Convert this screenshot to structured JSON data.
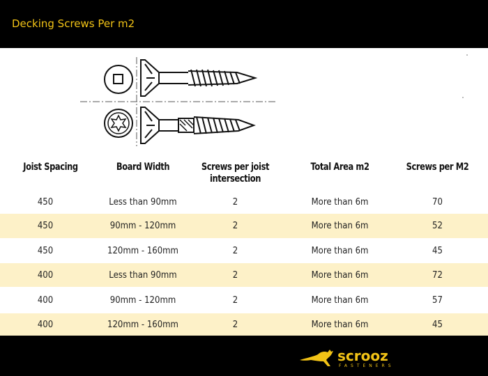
{
  "header": {
    "title": "Decking Screws Per m2"
  },
  "illustration": {
    "top_screw": "square-drive-screw",
    "bottom_screw": "torx-drive-screw"
  },
  "table": {
    "columns": [
      "Joist Spacing",
      "Board Width",
      "Screws per joist intersection",
      "Total Area m2",
      "Screws per M2"
    ],
    "rows": [
      [
        "450",
        "Less than 90mm",
        "2",
        "More than 6m",
        "70"
      ],
      [
        "450",
        "90mm - 120mm",
        "2",
        "More than 6m",
        "52"
      ],
      [
        "450",
        "120mm - 160mm",
        "2",
        "More than 6m",
        "45"
      ],
      [
        "400",
        "Less than 90mm",
        "2",
        "More than 6m",
        "72"
      ],
      [
        "400",
        "90mm - 120mm",
        "2",
        "More than 6m",
        "57"
      ],
      [
        "400",
        "120mm - 160mm",
        "2",
        "More than 6m",
        "45"
      ]
    ]
  },
  "footer": {
    "brand": "scrooz",
    "tagline": "FASTENERS"
  },
  "colors": {
    "accent": "#f2c316",
    "row_alt": "#fdf1c8",
    "dark": "#000000"
  }
}
